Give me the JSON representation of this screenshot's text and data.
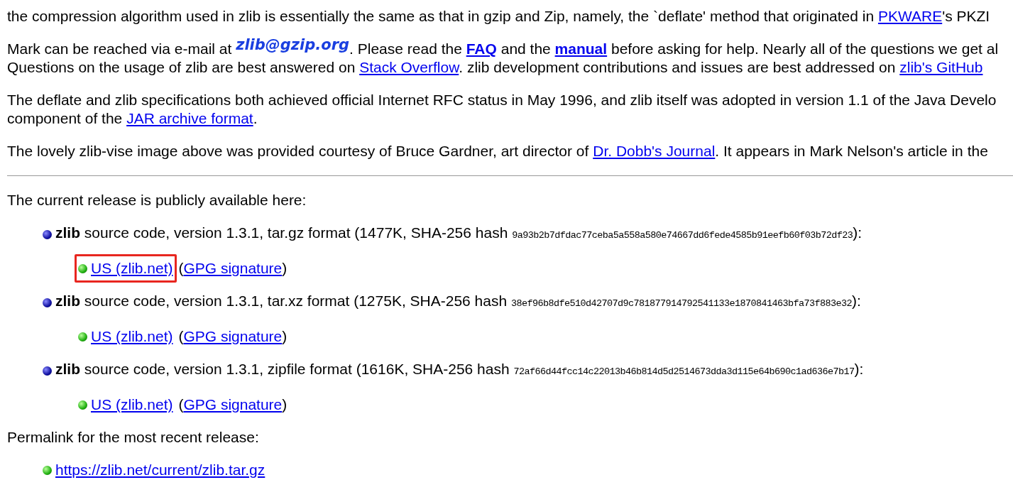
{
  "intro": [
    {
      "lines": [
        [
          {
            "kind": "text",
            "text": "the compression algorithm used in zlib is essentially the same as that in gzip and Zip, namely, the `deflate' method that originated in "
          },
          {
            "kind": "link",
            "text": "PKWARE"
          },
          {
            "kind": "text",
            "text": "'s PKZI"
          }
        ]
      ]
    },
    {
      "lines": [
        [
          {
            "kind": "text",
            "text": "Mark can be reached via e-mail at "
          },
          {
            "kind": "email",
            "text": "zlib@gzip.org"
          },
          {
            "kind": "text",
            "text": ". Please read the "
          },
          {
            "kind": "bold-link",
            "text": "FAQ"
          },
          {
            "kind": "text",
            "text": " and the "
          },
          {
            "kind": "bold-link",
            "text": "manual"
          },
          {
            "kind": "text",
            "text": " before asking for help. Nearly all of the questions we get al"
          }
        ],
        [
          {
            "kind": "text",
            "text": "Questions on the usage of zlib are best answered on "
          },
          {
            "kind": "link",
            "text": "Stack Overflow"
          },
          {
            "kind": "text",
            "text": ". zlib development contributions and issues are best addressed on "
          },
          {
            "kind": "link",
            "text": "zlib's GitHub"
          }
        ]
      ]
    },
    {
      "lines": [
        [
          {
            "kind": "text",
            "text": "The deflate and zlib specifications both achieved official Internet RFC status in May 1996, and zlib itself was adopted in version 1.1 of the Java Develo"
          }
        ],
        [
          {
            "kind": "text",
            "text": "component of the "
          },
          {
            "kind": "link",
            "text": "JAR archive format"
          },
          {
            "kind": "text",
            "text": "."
          }
        ]
      ]
    },
    {
      "lines": [
        [
          {
            "kind": "text",
            "text": "The lovely zlib-vise image above was provided courtesy of Bruce Gardner, art director of "
          },
          {
            "kind": "link",
            "text": "Dr. Dobb's Journal"
          },
          {
            "kind": "text",
            "text": ". It appears in Mark Nelson's article in the"
          }
        ]
      ]
    }
  ],
  "release_heading": "The current release is publicly available here:",
  "downloads": [
    {
      "name": "zlib",
      "description": "source code, version 1.3.1, tar.gz format (1477K, SHA-256 hash ",
      "hash": "9a93b2b7dfdac77ceba5a558a580e74667dd6fede4585b91eefb60f03b72df23",
      "suffix": "):",
      "mirror": "US (zlib.net)",
      "highlighted": true,
      "open": "(",
      "signature": "GPG signature",
      "close": ")"
    },
    {
      "name": "zlib",
      "description": "source code, version 1.3.1, tar.xz format (1275K, SHA-256 hash ",
      "hash": "38ef96b8dfe510d42707d9c781877914792541133e1870841463bfa73f883e32",
      "suffix": "):",
      "mirror": "US (zlib.net)",
      "highlighted": false,
      "open": "(",
      "signature": "GPG signature",
      "close": ")"
    },
    {
      "name": "zlib",
      "description": "source code, version 1.3.1, zipfile format (1616K, SHA-256 hash ",
      "hash": "72af66d44fcc14c22013b46b814d5d2514673dda3d115e64b690c1ad636e7b17",
      "suffix": "):",
      "mirror": "US (zlib.net)",
      "highlighted": false,
      "open": "(",
      "signature": "GPG signature",
      "close": ")"
    }
  ],
  "permalink_heading": "Permalink for the most recent release:",
  "permalink": "https://zlib.net/current/zlib.tar.gz"
}
